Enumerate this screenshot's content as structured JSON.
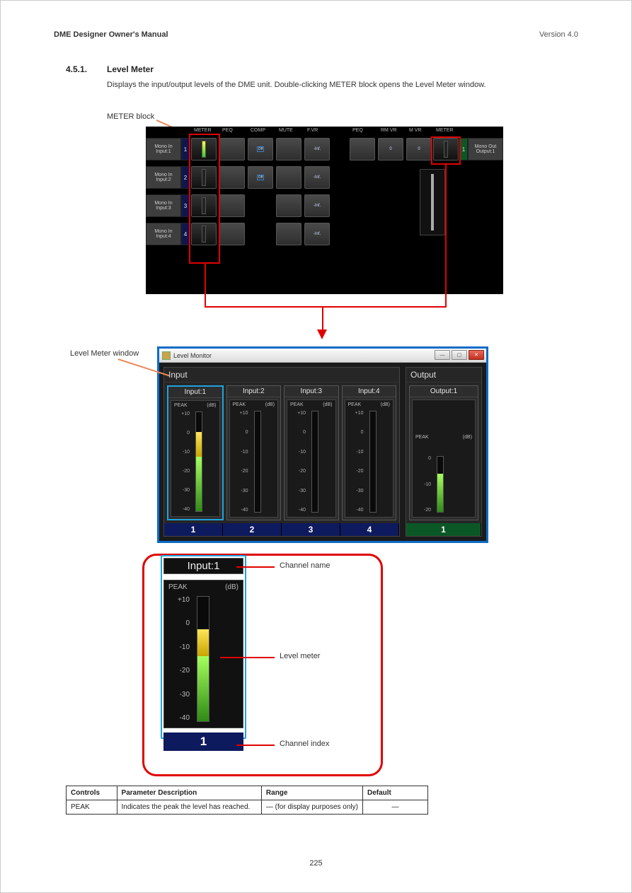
{
  "page_header": {
    "title": "DME Designer Owner's Manual",
    "version": "Version 4.0"
  },
  "section": {
    "index": "4.5.1.",
    "name": "Level Meter",
    "desc": "Displays the input/output levels of the DME unit. Double-clicking METER block opens the Level Meter window."
  },
  "flowpanel": {
    "head_in": [
      "METER",
      "PEQ",
      "COMP",
      "MUTE",
      "F.VR"
    ],
    "head_out": [
      "PEQ",
      "RM VR",
      "M VR",
      "METER"
    ],
    "inputs": [
      {
        "name": "Mono In",
        "sub": "Input:1",
        "num": "1",
        "comp": "Off",
        "fvr": "-Inf."
      },
      {
        "name": "Mono In",
        "sub": "Input:2",
        "num": "2",
        "comp": "Off",
        "fvr": "-Inf."
      },
      {
        "name": "Mono In",
        "sub": "Input:3",
        "num": "3",
        "fvr": "-Inf."
      },
      {
        "name": "Mono In",
        "sub": "Input:4",
        "num": "4",
        "fvr": "-Inf."
      }
    ],
    "out_row": {
      "peq": "",
      "rmvr": "0",
      "mvr": "0"
    },
    "output": {
      "name": "Mono Out",
      "sub": "Output:1",
      "num": "1"
    }
  },
  "top_annotation": "METER block",
  "level_monitor": {
    "window_title": "Level Monitor",
    "input_label": "Input",
    "output_label": "Output",
    "peak_label": "PEAK",
    "db_label": "(dB)",
    "inputs": [
      {
        "name": "Input:1",
        "num": "1",
        "selected": true,
        "scale": [
          "+10",
          "0",
          "-10",
          "-20",
          "-30",
          "-40"
        ],
        "fill_green": 40,
        "fill_yellow": 20,
        "fill_red": 0
      },
      {
        "name": "Input:2",
        "num": "2",
        "selected": false,
        "scale": [
          "+10",
          "0",
          "-10",
          "-20",
          "-30",
          "-40"
        ],
        "fill_green": 0,
        "fill_yellow": 0,
        "fill_red": 0
      },
      {
        "name": "Input:3",
        "num": "3",
        "selected": false,
        "scale": [
          "+10",
          "0",
          "-10",
          "-20",
          "-30",
          "-40"
        ],
        "fill_green": 0,
        "fill_yellow": 0,
        "fill_red": 0
      },
      {
        "name": "Input:4",
        "num": "4",
        "selected": false,
        "scale": [
          "+10",
          "0",
          "-10",
          "-20",
          "-30",
          "-40"
        ],
        "fill_green": 0,
        "fill_yellow": 0,
        "fill_red": 0
      }
    ],
    "outputs": [
      {
        "name": "Output:1",
        "num": "1",
        "scale": [
          "0",
          "-10",
          "-20"
        ],
        "fill_green": 55
      }
    ]
  },
  "zoom": {
    "name": "Input:1",
    "num": "1",
    "scale": [
      "+10",
      "0",
      "-10",
      "-20",
      "-30",
      "-40"
    ]
  },
  "leaders": {
    "name": "Channel name",
    "meter": "Level meter",
    "index": "Channel index"
  },
  "lm_annotation": "Level Meter window",
  "table": {
    "head": [
      "Controls",
      "Parameter Description",
      "Range",
      "Default"
    ],
    "row": [
      "PEAK",
      "Indicates the peak the level has reached.",
      "— (for display purposes only)",
      "—"
    ]
  },
  "page_number": "225"
}
